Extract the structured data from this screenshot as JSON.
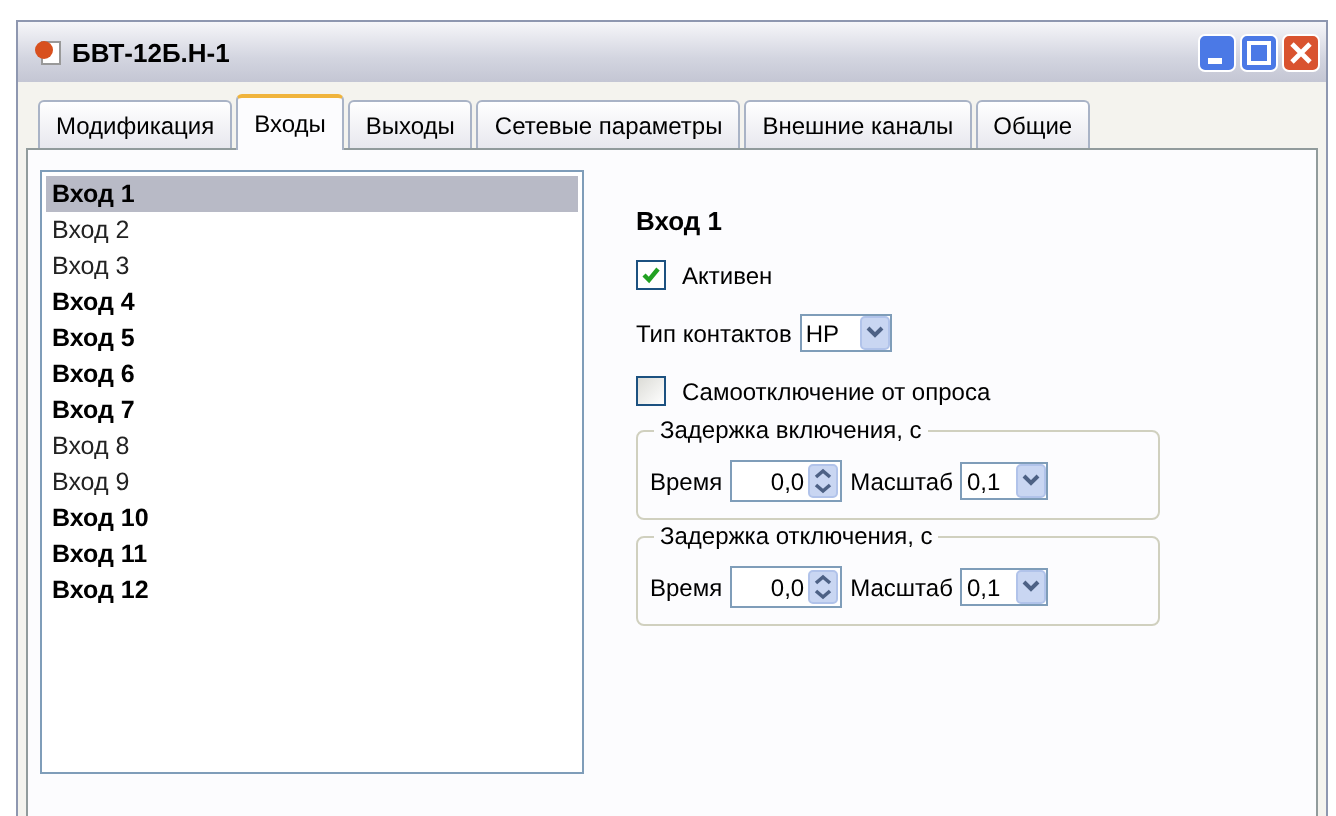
{
  "window": {
    "title": "БВТ-12Б.Н-1"
  },
  "tabs": [
    {
      "label": "Модификация",
      "selected": false
    },
    {
      "label": "Входы",
      "selected": true
    },
    {
      "label": "Выходы",
      "selected": false
    },
    {
      "label": "Сетевые параметры",
      "selected": false
    },
    {
      "label": "Внешние каналы",
      "selected": false
    },
    {
      "label": "Общие",
      "selected": false
    }
  ],
  "inputs": [
    {
      "label": "Вход 1",
      "active": true,
      "selected": true
    },
    {
      "label": "Вход 2",
      "active": false,
      "selected": false
    },
    {
      "label": "Вход 3",
      "active": false,
      "selected": false
    },
    {
      "label": "Вход 4",
      "active": true,
      "selected": false
    },
    {
      "label": "Вход 5",
      "active": true,
      "selected": false
    },
    {
      "label": "Вход 6",
      "active": true,
      "selected": false
    },
    {
      "label": "Вход 7",
      "active": true,
      "selected": false
    },
    {
      "label": "Вход 8",
      "active": false,
      "selected": false
    },
    {
      "label": "Вход 9",
      "active": false,
      "selected": false
    },
    {
      "label": "Вход 10",
      "active": true,
      "selected": false
    },
    {
      "label": "Вход 11",
      "active": true,
      "selected": false
    },
    {
      "label": "Вход 12",
      "active": true,
      "selected": false
    }
  ],
  "details": {
    "heading": "Вход 1",
    "active": {
      "label": "Активен",
      "checked": true
    },
    "contact_type": {
      "label": "Тип контактов",
      "value": "НР"
    },
    "self_disconnect": {
      "label": "Самоотключение от опроса",
      "checked": false
    },
    "groups": [
      {
        "title": "Задержка включения, с",
        "time_label": "Время",
        "time_value": "0,0",
        "scale_label": "Масштаб",
        "scale_value": "0,1"
      },
      {
        "title": "Задержка отключения, с",
        "time_label": "Время",
        "time_value": "0,0",
        "scale_label": "Масштаб",
        "scale_value": "0,1"
      }
    ]
  }
}
